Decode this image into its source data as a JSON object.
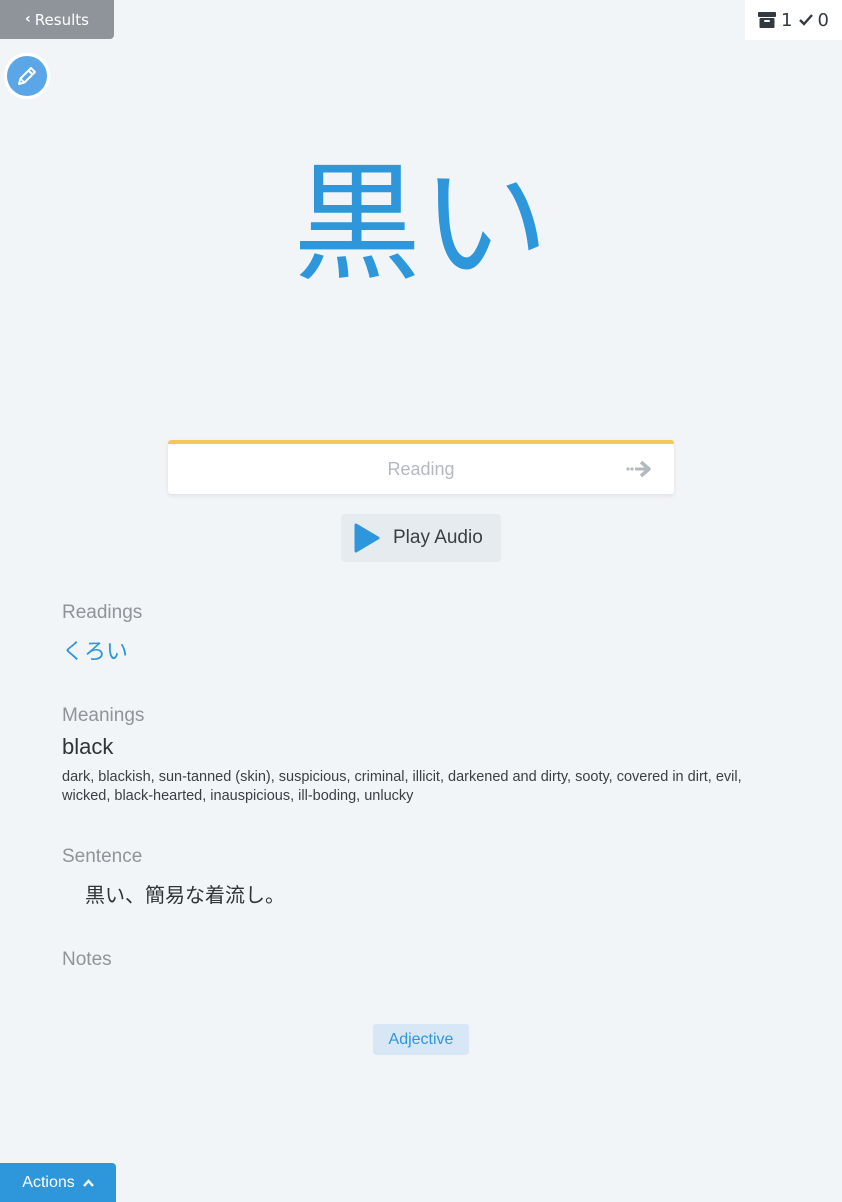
{
  "nav": {
    "back_label": "Results"
  },
  "counters": {
    "archive_count": "1",
    "correct_count": "0",
    "archive_icon": "archive-icon",
    "check_icon": "check-icon"
  },
  "edit": {
    "icon": "pencil-icon"
  },
  "card": {
    "word": "黒い"
  },
  "reading_input": {
    "placeholder": "Reading",
    "value": ""
  },
  "audio": {
    "label": "Play Audio"
  },
  "sections": {
    "readings_label": "Readings",
    "readings_value": "くろい",
    "meanings_label": "Meanings",
    "meaning_primary": "black",
    "meaning_alternatives": "dark, blackish, sun-tanned (skin), suspicious, criminal, illicit, darkened and dirty, sooty, covered in dirt, evil, wicked, black-hearted, inauspicious, ill-boding, unlucky",
    "sentence_label": "Sentence",
    "sentence_value": "黒い、簡易な着流し。",
    "notes_label": "Notes"
  },
  "tags": {
    "part_of_speech": "Adjective"
  },
  "footer": {
    "actions_label": "Actions"
  },
  "colors": {
    "accent": "#2e97db",
    "reading_border": "#f2c75c",
    "back_button": "#8f949b",
    "tag_bg": "#d8e7f5"
  }
}
